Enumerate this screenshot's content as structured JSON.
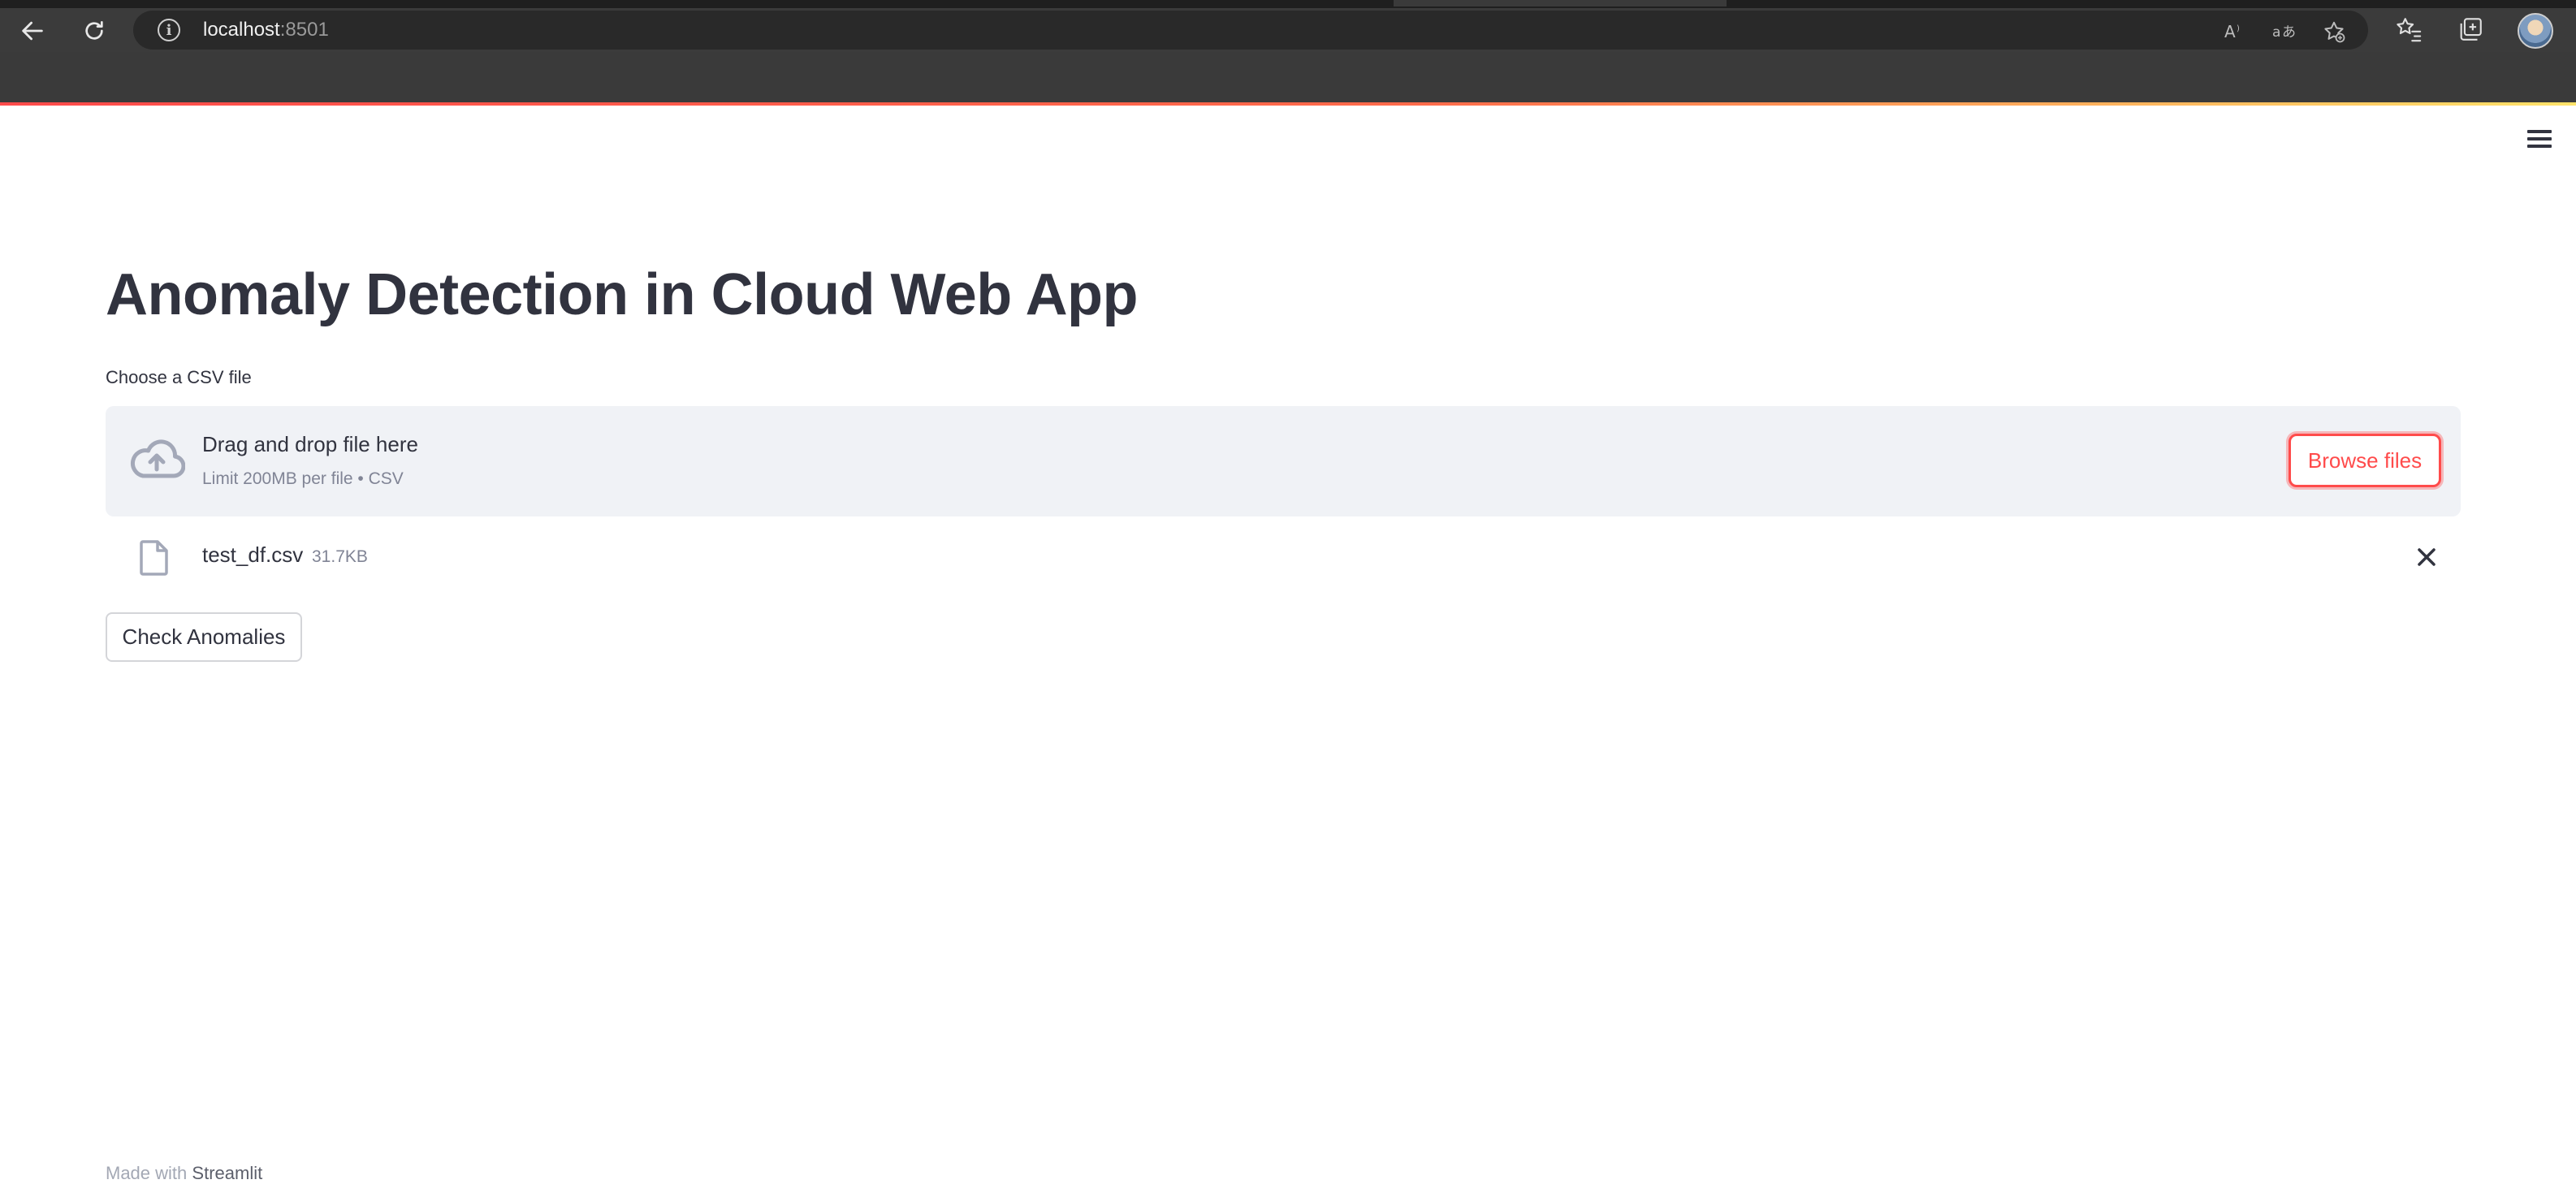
{
  "browser": {
    "url_host": "localhost",
    "url_port": ":8501",
    "icons": [
      "back-arrow-icon",
      "reload-icon",
      "site-info-icon",
      "read-aloud-icon",
      "translate-icon",
      "add-favorite-icon",
      "favorites-icon",
      "collections-icon",
      "profile-avatar"
    ]
  },
  "app": {
    "menu_icon": "hamburger-menu-icon",
    "title": "Anomaly Detection in Cloud Web App",
    "uploader": {
      "label": "Choose a CSV file",
      "drop_text": "Drag and drop file here",
      "limit_text": "Limit 200MB per file • CSV",
      "browse_label": "Browse files",
      "icon": "cloud-upload-icon"
    },
    "uploaded_file": {
      "name": "test_df.csv",
      "size": "31.7KB",
      "icon": "file-icon",
      "remove_icon": "close-icon"
    },
    "check_button_label": "Check Anomalies",
    "footer": {
      "prefix": "Made with",
      "link": "Streamlit"
    }
  },
  "colors": {
    "primary": "#ff4b4b",
    "text": "#31333f",
    "muted": "#808495",
    "dropzone_bg": "#f0f2f6",
    "chrome_bg": "#3b3b3b"
  }
}
